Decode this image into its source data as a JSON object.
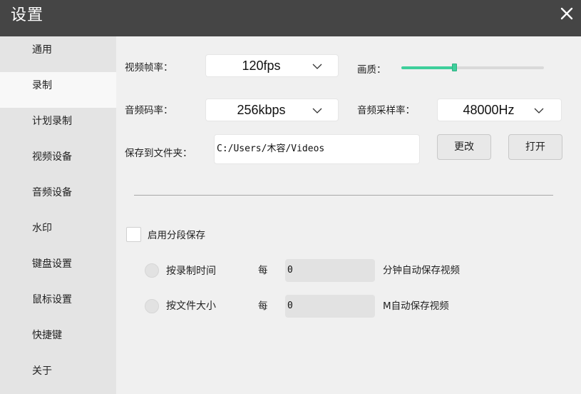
{
  "window": {
    "title": "设置",
    "close_icon": "close-icon"
  },
  "sidebar": {
    "items": [
      {
        "label": "通用"
      },
      {
        "label": "录制",
        "active": true
      },
      {
        "label": "计划录制"
      },
      {
        "label": "视频设备"
      },
      {
        "label": "音频设备"
      },
      {
        "label": "水印"
      },
      {
        "label": "键盘设置"
      },
      {
        "label": "鼠标设置"
      },
      {
        "label": "快捷键"
      },
      {
        "label": "关于"
      }
    ]
  },
  "record": {
    "frame_rate": {
      "label": "视频帧率：",
      "value": "120fps"
    },
    "quality": {
      "label": "画质：",
      "level_fraction": 0.37
    },
    "audio_bitrate": {
      "label": "音频码率：",
      "value": "256kbps"
    },
    "audio_sample_rate": {
      "label": "音频采样率：",
      "value": "48000Hz"
    },
    "save_folder": {
      "label": "保存到文件夹：",
      "value": "C:/Users/木容/Videos",
      "change_button": "更改",
      "open_button": "打开"
    },
    "segment": {
      "enable_label": "启用分段保存",
      "enabled": false,
      "by_time": {
        "label": "按录制时间",
        "every": "每",
        "value": "0",
        "suffix": "分钟自动保存视频"
      },
      "by_size": {
        "label": "按文件大小",
        "every": "每",
        "value": "0",
        "suffix": "M自动保存视频"
      }
    }
  },
  "colors": {
    "titlebar": "#454545",
    "sidebar": "#e4e4e4",
    "sidebar_active": "#f8f8f8",
    "content": "#f0f0f0",
    "accent": "#3ecf9b"
  }
}
